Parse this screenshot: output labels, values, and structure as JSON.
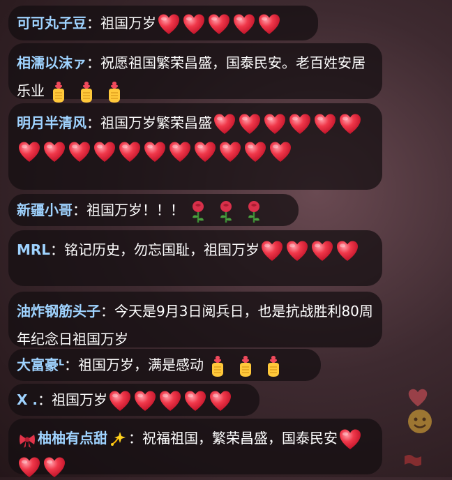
{
  "messages": [
    {
      "name": "可可丸子豆",
      "sep": "：",
      "text": "祖国万岁",
      "hearts": 5,
      "hands": 0,
      "roses": 0
    },
    {
      "name": "相濡以沫ァ",
      "sep": "：",
      "text": "祝愿祖国繁荣昌盛，国泰民安。老百姓安居乐业",
      "hearts": 0,
      "hands": 3,
      "roses": 0
    },
    {
      "name": "明月半清风",
      "sep": "：",
      "text": "祖国万岁繁荣昌盛",
      "hearts": 17,
      "hands": 0,
      "roses": 0
    },
    {
      "name": "新疆小哥",
      "sep": "：",
      "text": "祖国万岁！！！",
      "hearts": 0,
      "hands": 0,
      "roses": 3
    },
    {
      "name": "MRL",
      "sep": "：",
      "text": "铭记历史，勿忘国耻，祖国万岁",
      "hearts": 4,
      "hands": 0,
      "roses": 0
    },
    {
      "name": "油炸钢筋头子",
      "sep": "：",
      "text": "今天是9月3日阅兵日，也是抗战胜利80周年纪念日祖国万岁",
      "hearts": 0,
      "hands": 0,
      "roses": 0
    },
    {
      "name": "大富豪ᴸ",
      "sep": "：",
      "text": "祖国万岁，满是感动",
      "hearts": 0,
      "hands": 3,
      "roses": 0
    },
    {
      "name": "X .",
      "sep": "：",
      "text": "祖国万岁",
      "hearts": 5,
      "hands": 0,
      "roses": 0
    },
    {
      "name": "柚柚有点甜",
      "sep": "：",
      "text": "祝福祖国，繁荣昌盛，国泰民安",
      "hearts": 3,
      "hands": 0,
      "roses": 0,
      "prefix_icon": "bow-icon",
      "suffix_icon": "sparkle-icon"
    }
  ],
  "colors": {
    "name": "#9fd3ff",
    "text": "#ffffff",
    "bubble": "rgba(20,14,16,0.72)",
    "heart": "#f0384a"
  }
}
